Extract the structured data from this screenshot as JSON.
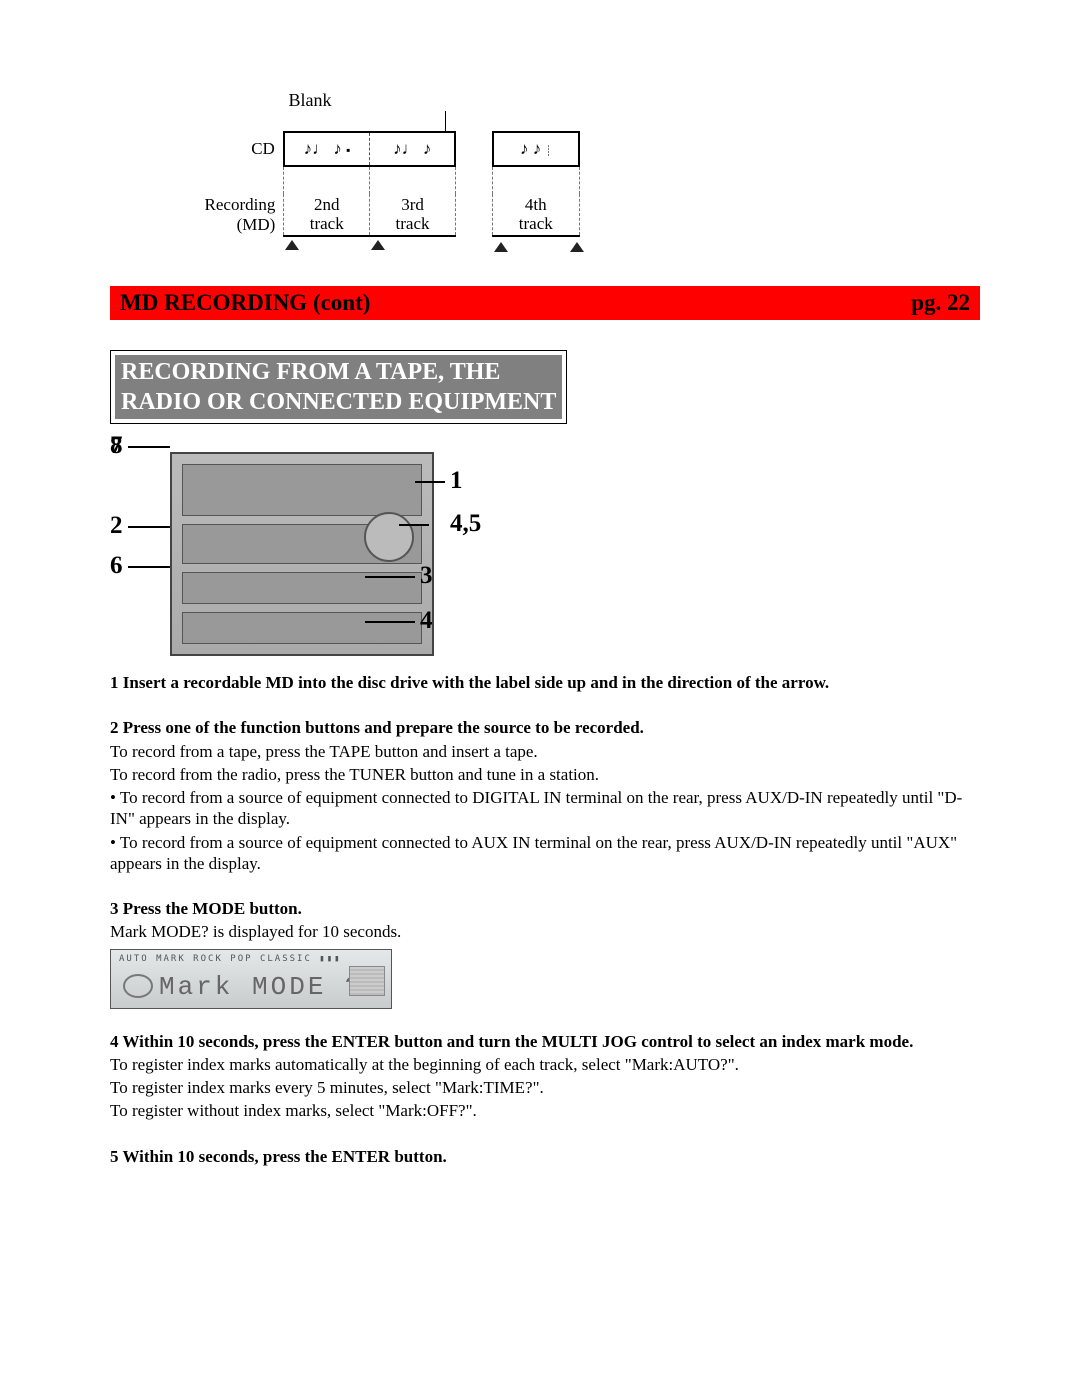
{
  "diagram": {
    "blank_label": "Blank",
    "cd_label": "CD",
    "md_label": "Recording (MD)",
    "tracks": [
      "2nd\ntrack",
      "3rd\ntrack",
      "4th\ntrack"
    ],
    "notes": [
      "♪♩ ♪",
      "♪♩ ♪",
      "♪ ♪"
    ]
  },
  "banner": {
    "title": "MD RECORDING (cont)",
    "page": "pg. 22"
  },
  "section_title": "RECORDING FROM A TAPE, THE\nRADIO OR CONNECTED EQUIPMENT",
  "equipment_callouts": {
    "left": [
      "8",
      "7",
      "2",
      "6"
    ],
    "right": [
      "1",
      "4,5",
      "3",
      "4"
    ]
  },
  "steps": {
    "s1": "1 Insert a recordable MD into the disc drive with the label side up and in the direction of the arrow.",
    "s2": "2 Press one of the function buttons and prepare the source to be recorded.",
    "s2a": "To record from a tape, press the TAPE button and insert a tape.",
    "s2b": "To record from the radio, press the TUNER button and tune in a station.",
    "s2c": "• To record from a source of equipment connected to DIGITAL IN terminal on the rear, press AUX/D-IN repeatedly until \"D-IN\" appears in the display.",
    "s2d": "• To record from a source of equipment connected to AUX IN terminal on the rear, press AUX/D-IN repeatedly until \"AUX\" appears in the display.",
    "s3": "3 Press the MODE button.",
    "s3a": "Mark MODE? is displayed for 10 seconds.",
    "s4": "4 Within 10 seconds, press the ENTER button and turn the MULTI JOG control to select an index mark mode.",
    "s4a": "To register index marks automatically at the beginning of each track, select \"Mark:AUTO?\".",
    "s4b": "To register index marks every 5 minutes, select \"Mark:TIME?\".",
    "s4c": "To register without index marks, select \"Mark:OFF?\".",
    "s5": "5 Within 10 seconds, press the ENTER button."
  },
  "lcd": {
    "top_icons": "AUTO MARK    ROCK  POP  CLASSIC  ▮▮▮",
    "main": "Mark MODE ?"
  }
}
